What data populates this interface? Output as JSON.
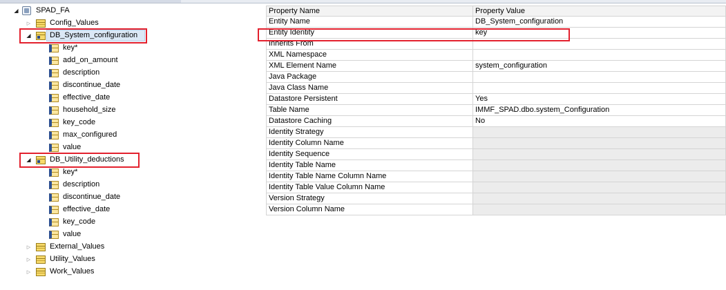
{
  "tree": {
    "root": {
      "label": "SPAD_FA",
      "icon": "database-icon"
    },
    "config_values": {
      "label": "Config_Values",
      "icon": "table-icon"
    },
    "db_system_configuration": {
      "label": "DB_System_configuration",
      "icon": "entity-icon",
      "attributes": [
        "key*",
        "add_on_amount",
        "description",
        "discontinue_date",
        "effective_date",
        "household_size",
        "key_code",
        "max_configured",
        "value"
      ]
    },
    "db_utility_deductions": {
      "label": "DB_Utility_deductions",
      "icon": "entity-icon",
      "attributes": [
        "key*",
        "description",
        "discontinue_date",
        "effective_date",
        "key_code",
        "value"
      ]
    },
    "external_values": {
      "label": "External_Values",
      "icon": "table-icon"
    },
    "utility_values": {
      "label": "Utility_Values",
      "icon": "table-icon"
    },
    "work_values": {
      "label": "Work_Values",
      "icon": "table-icon"
    }
  },
  "properties": {
    "header": {
      "name": "Property Name",
      "value": "Property Value"
    },
    "rows": [
      {
        "name": "Entity Name",
        "value": "DB_System_configuration",
        "disabled": false
      },
      {
        "name": "Entity Identity",
        "value": "key",
        "disabled": false
      },
      {
        "name": "Inherits From",
        "value": "",
        "disabled": false
      },
      {
        "name": "XML Namespace",
        "value": "",
        "disabled": false
      },
      {
        "name": "XML Element Name",
        "value": "system_configuration",
        "disabled": false
      },
      {
        "name": "Java Package",
        "value": "",
        "disabled": false
      },
      {
        "name": "Java Class Name",
        "value": "",
        "disabled": false
      },
      {
        "name": "Datastore Persistent",
        "value": "Yes",
        "disabled": false
      },
      {
        "name": "Table Name",
        "value": "IMMF_SPAD.dbo.system_Configuration",
        "disabled": false
      },
      {
        "name": "Datastore Caching",
        "value": "No",
        "disabled": false
      },
      {
        "name": "Identity Strategy",
        "value": "",
        "disabled": true
      },
      {
        "name": "Identity Column Name",
        "value": "",
        "disabled": true
      },
      {
        "name": "Identity Sequence",
        "value": "",
        "disabled": true
      },
      {
        "name": "Identity Table Name",
        "value": "",
        "disabled": true
      },
      {
        "name": "Identity Table Name Column Name",
        "value": "",
        "disabled": true
      },
      {
        "name": "Identity Table Value Column Name",
        "value": "",
        "disabled": true
      },
      {
        "name": "Version Strategy",
        "value": "",
        "disabled": true
      },
      {
        "name": "Version Column Name",
        "value": "",
        "disabled": true
      }
    ]
  },
  "colors": {
    "highlight_box": "#e3202d",
    "disabled_cell": "#ececec",
    "grid_line": "#d4d4d4",
    "header_bg": "#f3f3f3",
    "selection_bg": "#dbe8f6"
  }
}
